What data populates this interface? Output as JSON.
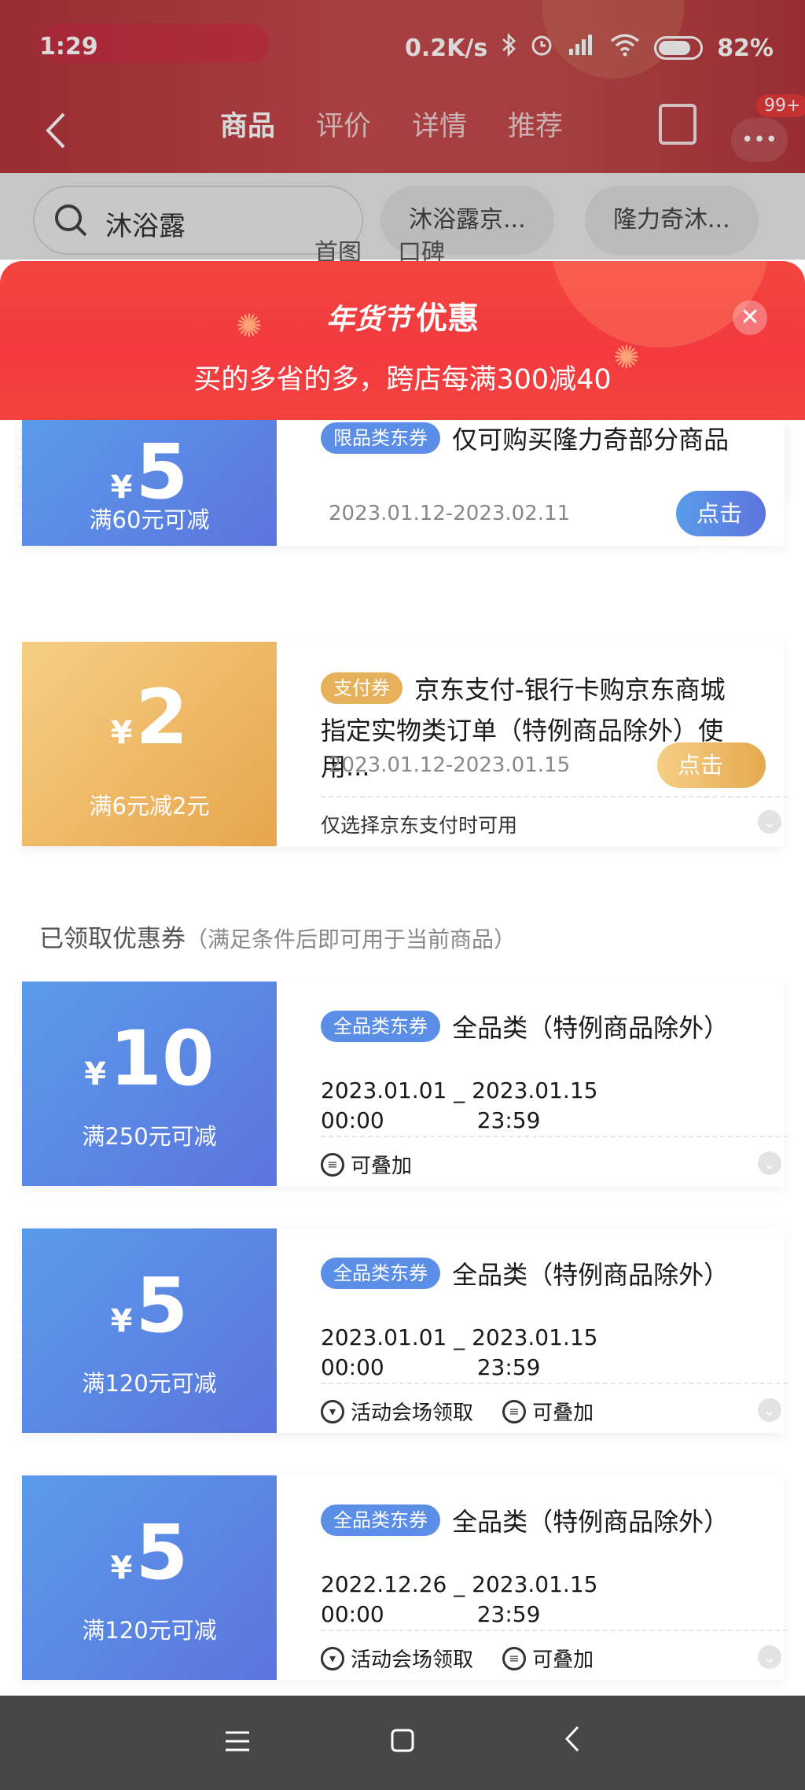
{
  "status_bar": {
    "time": "1:29",
    "net_speed": "0.2K/s",
    "battery": "82%"
  },
  "nav": {
    "tabs": [
      {
        "label": "商品",
        "active": true
      },
      {
        "label": "评价",
        "active": false
      },
      {
        "label": "详情",
        "active": false
      },
      {
        "label": "推荐",
        "active": false
      }
    ],
    "badge": "99+"
  },
  "search": {
    "value": "沐浴露",
    "chips": [
      "沐浴露京...",
      "隆力奇沐..."
    ],
    "ghost_tabs": [
      "首图",
      "口碑"
    ]
  },
  "sheet": {
    "title_logo": "年货节",
    "title": "优惠",
    "subtitle": "买的多省的多，跨店每满300减40"
  },
  "coupons_available": [
    {
      "currency": "¥",
      "amount": "5",
      "condition": "满60元可减",
      "tag": "限品类东券",
      "title": "仅可购买隆力奇部分商品",
      "date": "2023.01.12-2023.02.11",
      "button": "点击领取",
      "style": "blue"
    },
    {
      "currency": "¥",
      "amount": "2",
      "condition": "满6元减2元",
      "tag": "支付券",
      "title": "京东支付-银行卡购京东商城",
      "title2": "指定实物类订单（特例商品除外）使用...",
      "date": "2023.01.12-2023.01.15",
      "button": "点击领取",
      "note": "仅选择京东支付时可用",
      "style": "gold"
    }
  ],
  "claimed_section": {
    "label": "已领取优惠券",
    "hint": "（满足条件后即可用于当前商品）"
  },
  "coupons_claimed": [
    {
      "currency": "¥",
      "amount": "10",
      "condition": "满250元可减",
      "tag": "全品类东券",
      "title": "全品类（特例商品除外）",
      "start_date": "2023.01.01",
      "start_time": "00:00",
      "sep": "_",
      "end_date": "2023.01.15",
      "end_time": "23:59",
      "features": [
        "可叠加"
      ]
    },
    {
      "currency": "¥",
      "amount": "5",
      "condition": "满120元可减",
      "tag": "全品类东券",
      "title": "全品类（特例商品除外）",
      "start_date": "2023.01.01",
      "start_time": "00:00",
      "sep": "_",
      "end_date": "2023.01.15",
      "end_time": "23:59",
      "features": [
        "活动会场领取",
        "可叠加"
      ]
    },
    {
      "currency": "¥",
      "amount": "5",
      "condition": "满120元可减",
      "tag": "全品类东券",
      "title": "全品类（特例商品除外）",
      "start_date": "2022.12.26",
      "start_time": "00:00",
      "sep": "_",
      "end_date": "2023.01.15",
      "end_time": "23:59",
      "features": [
        "活动会场领取",
        "可叠加"
      ]
    }
  ],
  "colors": {
    "header_red": "#f2393f",
    "coupon_blue": "#5c74de",
    "coupon_gold": "#e7a54c"
  }
}
